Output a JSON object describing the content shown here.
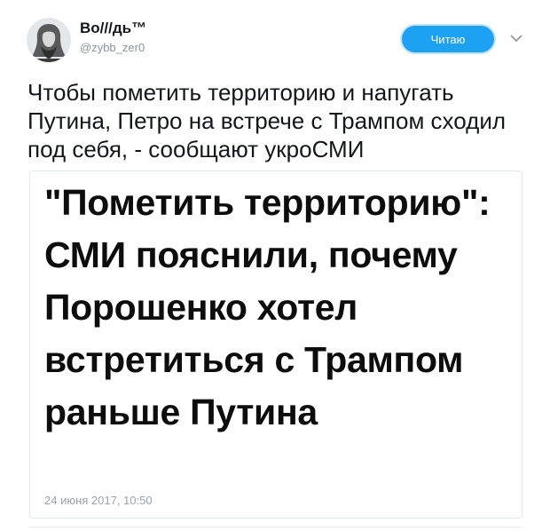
{
  "tweet": {
    "display_name": "Во///дь™",
    "username": "@zybb_zer0",
    "follow_label": "Читаю",
    "text": "Чтобы пометить территорию и напугать Путина, Петро на встрече с Трампом сходил под себя, - сообщают укроСМИ"
  },
  "card": {
    "headline": "\"Пометить территорию\": СМИ пояснили, почему Порошенко хотел встретиться с Трампом раньше Путина",
    "date": "24 июня 2017, 10:50"
  },
  "colors": {
    "accent": "#1da1f2",
    "text": "#14171a",
    "muted": "#8a959e"
  },
  "icons": {
    "avatar": "avatar-portrait",
    "menu": "chevron-down-icon"
  }
}
